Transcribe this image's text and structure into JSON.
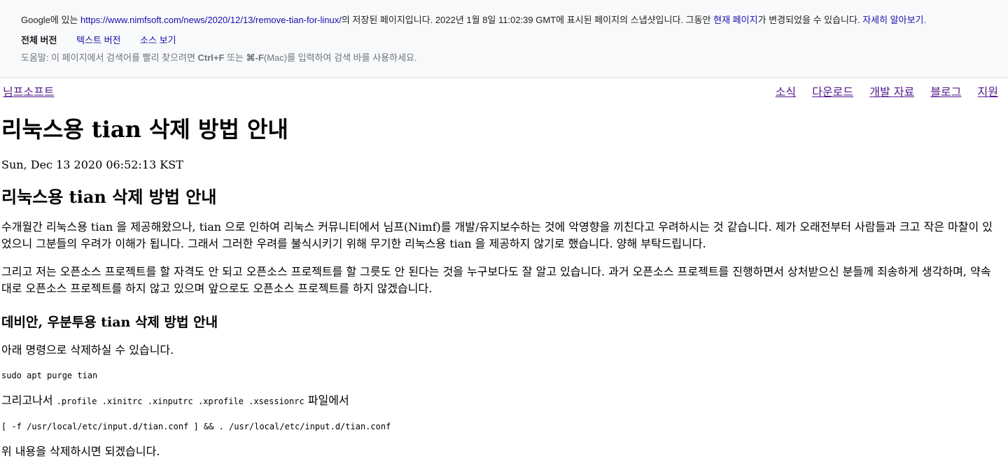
{
  "cache_banner": {
    "prefix": "Google에 있는 ",
    "url": "https://www.nimfsoft.com/news/2020/12/13/remove-tian-for-linux/",
    "middle": "의 저장된 페이지입니다. 2022년 1월 8일 11:02:39 GMT에 표시된 페이지의 스냅샷입니다. 그동안 ",
    "current_page_link": "현재 페이지",
    "suffix": "가 변경되었을 수 있습니다. ",
    "learn_more": "자세히 알아보기.",
    "tabs": {
      "full_version": "전체 버전",
      "text_version": "텍스트 버전",
      "view_source": "소스 보기"
    },
    "help": {
      "prefix": "도움말: 이 페이지에서 검색어를 빨리 찾으려면 ",
      "key1": "Ctrl+F",
      "middle": " 또는 ",
      "key2": "⌘-F",
      "suffix": "(Mac)를 입력하여 검색 바를 사용하세요."
    }
  },
  "site_nav": {
    "home": "님프소프트",
    "items": [
      "소식",
      "다운로드",
      "개발 자료",
      "블로그",
      "지원"
    ]
  },
  "article": {
    "title": "리눅스용 tian 삭제 방법 안내",
    "date": "Sun, Dec 13 2020 06:52:13 KST",
    "heading": "리눅스용 tian 삭제 방법 안내",
    "para1": "수개월간 리눅스용 tian 을 제공해왔으나, tian 으로 인하여 리눅스 커뮤니티에서 님프(Nimf)를 개발/유지보수하는 것에 악영향을 끼친다고 우려하시는 것 같습니다. 제가 오래전부터 사람들과 크고 작은 마찰이 있었으니 그분들의 우려가 이해가 됩니다. 그래서 그러한 우려를 불식시키기 위해 무기한 리눅스용 tian 을 제공하지 않기로 했습니다. 양해 부탁드립니다.",
    "para2": "그리고 저는 오픈소스 프로젝트를 할 자격도 안 되고 오픈소스 프로젝트를 할 그릇도 안 된다는 것을 누구보다도 잘 알고 있습니다. 과거 오픈소스 프로젝트를 진행하면서 상처받으신 분들께 죄송하게 생각하며, 약속대로 오픈소스 프로젝트를 하지 않고 있으며 앞으로도 오픈소스 프로젝트를 하지 않겠습니다.",
    "subheading": "데비안, 우분투용 tian 삭제 방법 안내",
    "para3": "아래 명령으로 삭제하실 수 있습니다.",
    "code1": "sudo apt purge tian",
    "para4_prefix": "그리고나서 ",
    "para4_files": ".profile .xinitrc .xinputrc .xprofile .xsessionrc",
    "para4_suffix": " 파일에서",
    "code2": "[ -f /usr/local/etc/input.d/tian.conf ] && . /usr/local/etc/input.d/tian.conf",
    "para5": "위 내용을 삭제하시면 되겠습니다."
  }
}
